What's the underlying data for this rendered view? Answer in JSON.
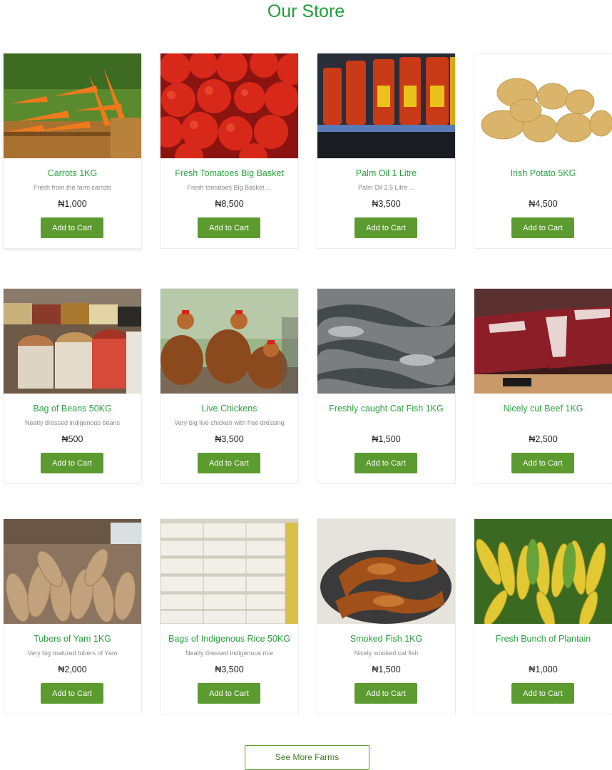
{
  "page": {
    "title": "Our Store"
  },
  "products": [
    {
      "name": "Carrots 1KG",
      "desc": "Fresh from the farm carrots",
      "price": "₦1,000",
      "button": "Add to Cart",
      "image_icon": "carrots-image"
    },
    {
      "name": "Fresh Tomatoes Big Basket",
      "desc": "Fresh tomatoes Big Basket ...",
      "price": "₦8,500",
      "button": "Add to Cart",
      "image_icon": "tomatoes-image"
    },
    {
      "name": "Palm Oil 1 Litre",
      "desc": "Palm Oil 2.5 Litre ...",
      "price": "₦3,500",
      "button": "Add to Cart",
      "image_icon": "palm-oil-image"
    },
    {
      "name": "Irish Potato 5KG",
      "desc": "",
      "price": "₦4,500",
      "button": "Add to Cart",
      "image_icon": "potatoes-image"
    },
    {
      "name": "Bag of Beans 50KG",
      "desc": "Neatly dressed indigenous beans",
      "price": "₦500",
      "button": "Add to Cart",
      "image_icon": "beans-image"
    },
    {
      "name": "Live Chickens",
      "desc": "Very big live chicken with free dressing",
      "price": "₦3,500",
      "button": "Add to Cart",
      "image_icon": "chickens-image"
    },
    {
      "name": "Freshly caught Cat Fish 1KG",
      "desc": "",
      "price": "₦1,500",
      "button": "Add to Cart",
      "image_icon": "catfish-image"
    },
    {
      "name": "Nicely cut Beef 1KG",
      "desc": "",
      "price": "₦2,500",
      "button": "Add to Cart",
      "image_icon": "beef-image"
    },
    {
      "name": "Tubers of Yam 1KG",
      "desc": "Very big matured tubers of Yam",
      "price": "₦2,000",
      "button": "Add to Cart",
      "image_icon": "yam-image"
    },
    {
      "name": "Bags of Indigenous Rice 50KG",
      "desc": "Neatly dressed indigenous rice",
      "price": "₦3,500",
      "button": "Add to Cart",
      "image_icon": "rice-image"
    },
    {
      "name": "Smoked Fish 1KG",
      "desc": "Nicely smoked cat fish",
      "price": "₦1,500",
      "button": "Add to Cart",
      "image_icon": "smoked-fish-image"
    },
    {
      "name": "Fresh Bunch of Plantain",
      "desc": "",
      "price": "₦1,000",
      "button": "Add to Cart",
      "image_icon": "plantain-image"
    }
  ],
  "footer": {
    "see_more": "See More Farms"
  },
  "colors": {
    "title": "#1f9d3a",
    "product_name": "#2aa33e",
    "button": "#5c9b30"
  }
}
